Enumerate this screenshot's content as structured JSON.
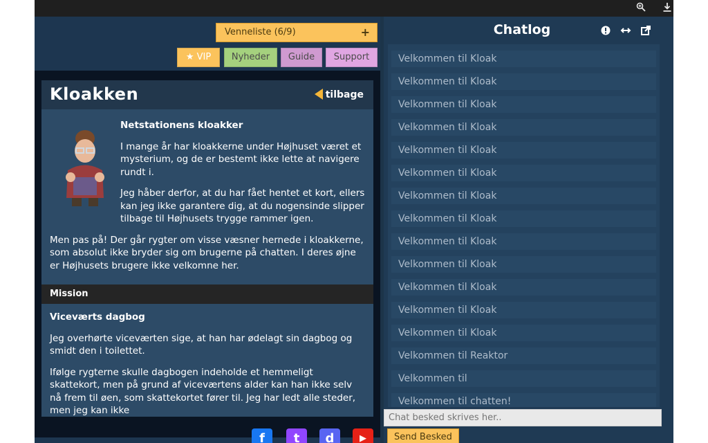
{
  "browser": {
    "zoom_icon": "zoom-icon",
    "download_icon": "download-icon"
  },
  "header": {
    "friend_list_label": "Venneliste (6/9)",
    "friend_list_plus": "+",
    "vip_label": "VIP",
    "news_label": "Nyheder",
    "guide_label": "Guide",
    "support_label": "Support",
    "colors": {
      "vip": "#fbc35c",
      "news": "#a5d17e",
      "guide": "#cf9ad0",
      "support": "#e0a6e2"
    }
  },
  "panel": {
    "title": "Kloakken",
    "back_label": "tilbage",
    "intro_heading": "Netstationens kloakker",
    "intro_para1": "I mange år har kloakkerne under Højhuset været et mysterium, og de er bestemt ikke lette at navigere rundt i.",
    "intro_para2": "Jeg håber derfor, at du har fået hentet et kort, ellers kan jeg ikke garantere dig, at du nogensinde slipper tilbage til Højhusets trygge rammer igen.",
    "warning": "Men pas på! Der går rygter om visse væsner hernede i kloakkerne, som absolut ikke bryder sig om brugerne på chatten. I deres øjne er Højhusets brugere ikke velkomne her.",
    "mission_label": "Mission",
    "mission_heading": "Viceværts dagbog",
    "mission_para1": "Jeg overhørte viceværten sige, at han har ødelagt sin dagbog og smidt den i toilettet.",
    "mission_para2": "Ifølge rygterne skulle dagbogen indeholde et hemmeligt skattekort, men på grund af viceværtens alder kan han ikke selv nå frem til øen, som skattekortet fører til. Jeg har ledt alle steder, men jeg kan ikke"
  },
  "chat": {
    "title": "Chatlog",
    "icons": [
      "info-icon",
      "resize-icon",
      "external-link-icon"
    ],
    "messages": [
      "Velkommen til Kloak",
      "Velkommen til Kloak",
      "Velkommen til Kloak",
      "Velkommen til Kloak",
      "Velkommen til Kloak",
      "Velkommen til Kloak",
      "Velkommen til Kloak",
      "Velkommen til Kloak",
      "Velkommen til Kloak",
      "Velkommen til Kloak",
      "Velkommen til Kloak",
      "Velkommen til Kloak",
      "Velkommen til Kloak",
      "Velkommen til Reaktor",
      "Velkommen til",
      "Velkommen til chatten!"
    ],
    "input_placeholder": "Chat besked skrives her..",
    "send_label": "Send Besked"
  },
  "social": {
    "facebook": {
      "glyph": "f",
      "color": "#1877f2"
    },
    "twitch": {
      "glyph": "t",
      "color": "#9146ff"
    },
    "discord": {
      "glyph": "d",
      "color": "#5865f2"
    },
    "youtube": {
      "glyph": "▶",
      "color": "#e62117"
    }
  }
}
